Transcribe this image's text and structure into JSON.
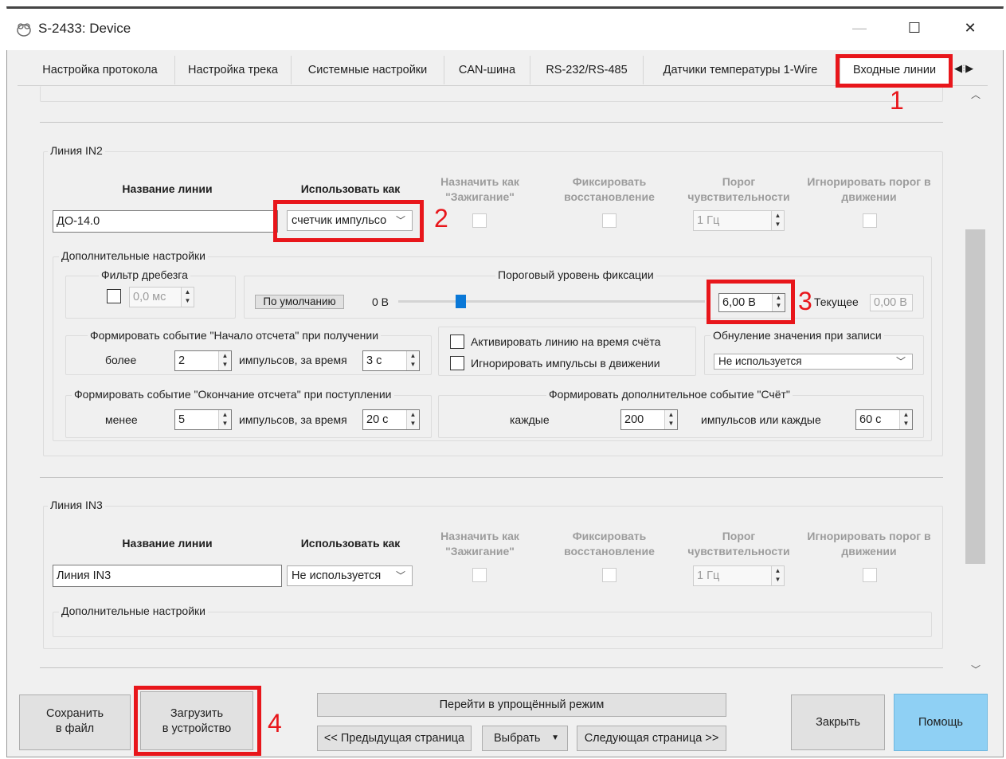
{
  "window": {
    "title": "S-2433: Device"
  },
  "tabs": [
    {
      "label": "Настройка протокола"
    },
    {
      "label": "Настройка трека"
    },
    {
      "label": "Системные настройки"
    },
    {
      "label": "CAN-шина"
    },
    {
      "label": "RS-232/RS-485"
    },
    {
      "label": "Датчики температуры 1-Wire"
    },
    {
      "label": "Входные линии"
    }
  ],
  "columns": {
    "name": "Название линии",
    "use_as": "Использовать как",
    "assign_ignition": "Назначить как \"Зажигание\"",
    "fix_restore": "Фиксировать восстановление",
    "threshold": "Порог чувствительности",
    "ignore_threshold": "Игнорировать порог в движении"
  },
  "in2": {
    "group_label": "Линия IN2",
    "name_value": "ДО-14.0",
    "use_as_value": "счетчик импульсо",
    "threshold_value": "1 Гц",
    "additional": {
      "label": "Дополнительные настройки",
      "debounce_label": "Фильтр дребезга",
      "debounce_value": "0,0 мс",
      "fix_level_label": "Пороговый уровень фиксации",
      "default_button": "По умолчанию",
      "slider_min": "0 В",
      "slider_value": 0.2,
      "level_value": "6,00 В",
      "current_label": "Текущее",
      "current_value": "0,00 В",
      "start_event_label": "Формировать событие \"Начало отсчета\" при получении",
      "start_more": "более",
      "start_pulses": "2",
      "start_pulses_label": "импульсов, за время",
      "start_time": "3 с",
      "activate_line_label": "Активировать линию на время счёта",
      "ignore_pulses_label": "Игнорировать импульсы в движении",
      "reset_label": "Обнуление значения при записи",
      "reset_value": "Не используется",
      "end_event_label": "Формировать событие \"Окончание отсчета\" при поступлении",
      "end_less": "менее",
      "end_pulses": "5",
      "end_pulses_label": "импульсов, за время",
      "end_time": "20 с",
      "count_event_label": "Формировать дополнительное событие \"Счёт\"",
      "every_label": "каждые",
      "every_value": "200",
      "every_pulses_label": "импульсов или каждые",
      "every_time": "60 с"
    }
  },
  "in3": {
    "group_label": "Линия IN3",
    "name_value": "Линия IN3",
    "use_as_value": "Не используется",
    "threshold_value": "1 Гц",
    "additional_label": "Дополнительные настройки"
  },
  "footer": {
    "save_label": "Сохранить в файл",
    "save_l1": "Сохранить",
    "save_l2": "в файл",
    "load_l1": "Загрузить",
    "load_l2": "в устройство",
    "simple_mode": "Перейти в упрощённый режим",
    "prev_page": "<< Предыдущая страница",
    "choose": "Выбрать",
    "next_page": "Следующая страница >>",
    "close": "Закрыть",
    "help": "Помощь"
  },
  "annotations": [
    "1",
    "2",
    "3",
    "4"
  ],
  "colors": {
    "annotation_red": "#e8161b",
    "help_button": "#8fd0f4",
    "slider_thumb": "#0a78d7"
  }
}
